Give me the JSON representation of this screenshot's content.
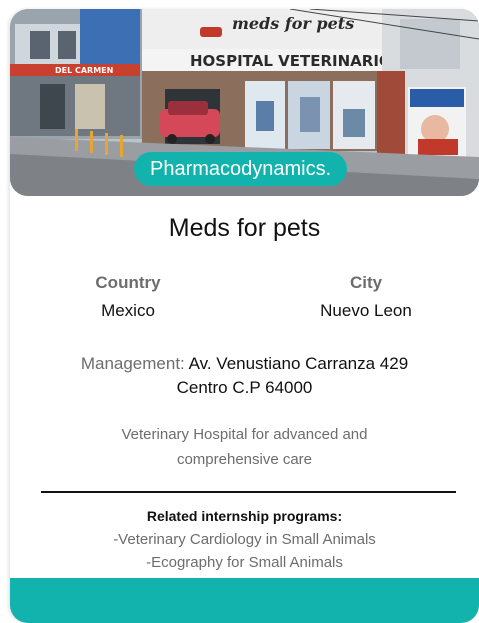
{
  "accent_color": "#13b3ad",
  "photo": {
    "storefront_brand": "meds for pets",
    "storefront_sign": "HOSPITAL VETERINARIO",
    "side_sign": "DEL CARMEN"
  },
  "category_pill": "Pharmacodynamics.",
  "title": "Meds for pets",
  "location": {
    "country_label": "Country",
    "country_value": "Mexico",
    "city_label": "City",
    "city_value": "Nuevo Leon"
  },
  "management": {
    "label": "Management:",
    "line1": "Av. Venustiano Carranza 429",
    "line2": "Centro C.P 64000"
  },
  "description": {
    "line1": "Veterinary Hospital for advanced and",
    "line2": "comprehensive care"
  },
  "related": {
    "title": "Related internship programs:",
    "items": [
      "-Veterinary Cardiology in Small Animals",
      "-Ecography for Small Animals"
    ]
  }
}
